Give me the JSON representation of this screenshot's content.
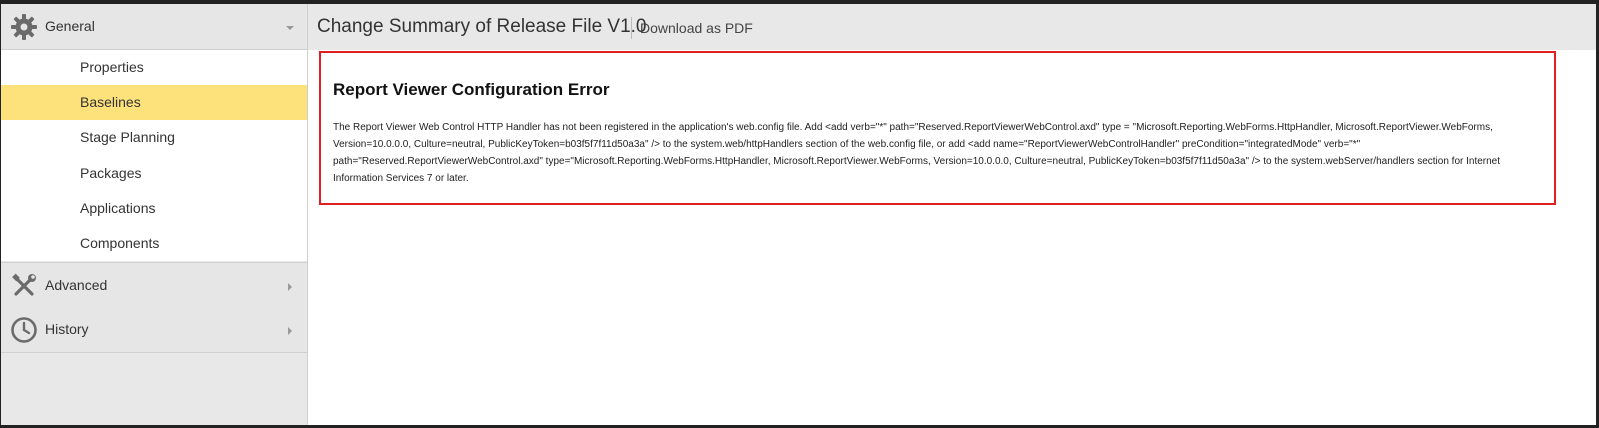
{
  "sidebar": {
    "general": {
      "label": "General",
      "icon": "gear-icon"
    },
    "items": [
      {
        "label": "Properties",
        "active": false
      },
      {
        "label": "Baselines",
        "active": true
      },
      {
        "label": "Stage Planning",
        "active": false
      },
      {
        "label": "Packages",
        "active": false
      },
      {
        "label": "Applications",
        "active": false
      },
      {
        "label": "Components",
        "active": false
      }
    ],
    "advanced": {
      "label": "Advanced",
      "icon": "tools-icon"
    },
    "history": {
      "label": "History",
      "icon": "clock-icon"
    }
  },
  "header": {
    "title": "Change Summary of Release File V1.0",
    "download_label": "Download as PDF"
  },
  "error": {
    "title": "Report Viewer Configuration Error",
    "message": "The Report Viewer Web Control HTTP Handler has not been registered in the application's web.config file. Add <add verb=\"*\" path=\"Reserved.ReportViewerWebControl.axd\" type = \"Microsoft.Reporting.WebForms.HttpHandler, Microsoft.ReportViewer.WebForms, Version=10.0.0.0, Culture=neutral, PublicKeyToken=b03f5f7f11d50a3a\" /> to the system.web/httpHandlers section of the web.config file, or add <add name=\"ReportViewerWebControlHandler\" preCondition=\"integratedMode\" verb=\"*\" path=\"Reserved.ReportViewerWebControl.axd\" type=\"Microsoft.Reporting.WebForms.HttpHandler, Microsoft.ReportViewer.WebForms, Version=10.0.0.0, Culture=neutral, PublicKeyToken=b03f5f7f11d50a3a\" /> to the system.webServer/handlers section for Internet Information Services 7 or later."
  },
  "colors": {
    "active_item": "#fde27c",
    "error_border": "#e02020",
    "sidebar_bg": "#e8e8e8"
  }
}
